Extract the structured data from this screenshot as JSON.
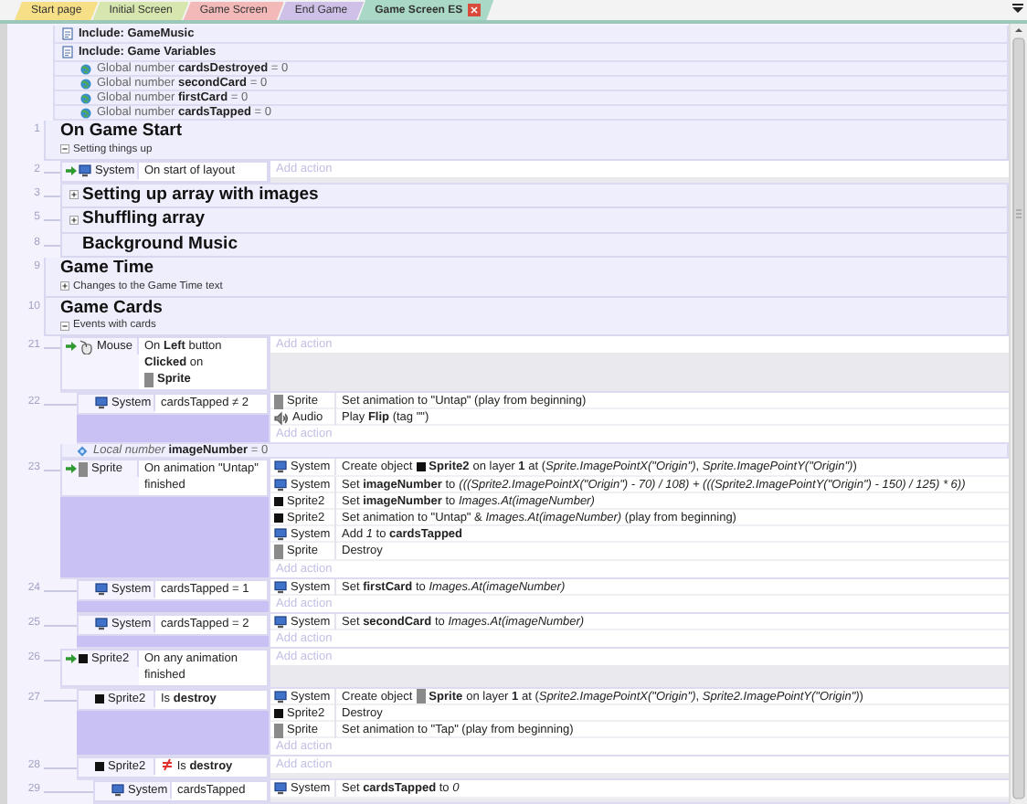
{
  "tabs": [
    {
      "label": "Start page",
      "selected": false,
      "color": "#f6df86"
    },
    {
      "label": "Initial Screen",
      "selected": false,
      "color": "#d6e6ae"
    },
    {
      "label": "Game Screen",
      "selected": false,
      "color": "#f3b9b9"
    },
    {
      "label": "End Game",
      "selected": false,
      "color": "#cfc0e8"
    },
    {
      "label": "Game Screen ES",
      "selected": true,
      "color": "#a9d8c6"
    }
  ],
  "sheet": [
    {
      "kind": "include",
      "text": "Include: GameMusic"
    },
    {
      "kind": "include",
      "text": "Include: Game Variables"
    },
    {
      "kind": "global",
      "text": "Global number **cardsDestroyed** = 0"
    },
    {
      "kind": "global",
      "text": "Global number **secondCard** = 0"
    },
    {
      "kind": "global",
      "text": "Global number **firstCard** = 0"
    },
    {
      "kind": "global",
      "text": "Global number **cardsTapped** = 0"
    },
    {
      "kind": "group",
      "line": "1",
      "title": "On Game Start",
      "description": "Setting things up",
      "expanded": true,
      "children": [
        {
          "kind": "event",
          "line": "2",
          "conditions": [
            {
              "kind": "system",
              "object": "System",
              "trigger": true,
              "inverted": false,
              "text": "On start of layout"
            }
          ],
          "add_action": "Add action"
        },
        {
          "kind": "group",
          "line": "3",
          "title": "Setting up array with images",
          "expanded": false
        },
        {
          "kind": "group",
          "line": "5",
          "title": "Shuffling array",
          "expanded": false
        },
        {
          "kind": "group",
          "line": "8",
          "title": "Background Music"
        }
      ]
    },
    {
      "kind": "group",
      "line": "9",
      "title": "Game Time",
      "description": "Changes to the Game Time text",
      "expanded": false
    },
    {
      "kind": "group",
      "line": "10",
      "title": "Game Cards",
      "description": "Events with cards",
      "expanded": true,
      "children": [
        {
          "kind": "event",
          "line": "21",
          "conditions": [
            {
              "kind": "mouse",
              "object": "Mouse",
              "trigger": true,
              "inverted": false,
              "text": "On **Left** button **Clicked** on",
              "target": {
                "kind": "sprite",
                "name": "Sprite"
              }
            }
          ],
          "add_action": "Add action",
          "children": [
            {
              "kind": "event",
              "line": "22",
              "conditions": [
                {
                  "kind": "system",
                  "object": "System",
                  "trigger": false,
                  "inverted": false,
                  "text": "cardsTapped ≠ 2"
                }
              ],
              "actions": [
                {
                  "kind": "sprite",
                  "object": "Sprite",
                  "text": "Set animation to \"Untap\" (play from beginning)"
                },
                {
                  "kind": "audio",
                  "object": "Audio",
                  "text": "Play **Flip** (tag \"\")"
                }
              ],
              "add_action": "Add action"
            }
          ]
        },
        {
          "kind": "local",
          "text": "*Local number* **imageNumber** = 0"
        },
        {
          "kind": "event",
          "line": "23",
          "conditions": [
            {
              "kind": "sprite",
              "object": "Sprite",
              "trigger": true,
              "inverted": false,
              "text": "On animation \"Untap\" finished"
            }
          ],
          "actions": [
            {
              "kind": "system",
              "object": "System",
              "text": "Create object",
              "target": {
                "kind": "sprite2",
                "name": "Sprite2"
              },
              "rest": "on layer **1** at (*Sprite.ImagePointX(\"Origin\")*, *Sprite.ImagePointY(\"Origin\")*)"
            },
            {
              "kind": "system",
              "object": "System",
              "text": "Set **imageNumber** to",
              "expression": "(((Sprite2.ImagePointX(\"Origin\") - 70) / 108) + (((Sprite2.ImagePointY(\"Origin\") - 150) / 125) * 6))"
            },
            {
              "kind": "sprite2",
              "object": "Sprite2",
              "text": "Set **imageNumber** to *Images.At(imageNumber)*"
            },
            {
              "kind": "sprite2",
              "object": "Sprite2",
              "text": "Set animation to \"Untap\" & *Images.At(imageNumber)* (play from beginning)"
            },
            {
              "kind": "system",
              "object": "System",
              "text": "Add *1* to **cardsTapped**"
            },
            {
              "kind": "sprite",
              "object": "Sprite",
              "text": "Destroy"
            }
          ],
          "add_action": "Add action",
          "children": [
            {
              "kind": "event",
              "line": "24",
              "conditions": [
                {
                  "kind": "system",
                  "object": "System",
                  "trigger": false,
                  "inverted": false,
                  "text": "cardsTapped = 1"
                }
              ],
              "actions": [
                {
                  "kind": "system",
                  "object": "System",
                  "text": "Set **firstCard** to *Images.At(imageNumber)*"
                }
              ],
              "add_action": "Add action"
            },
            {
              "kind": "event",
              "line": "25",
              "conditions": [
                {
                  "kind": "system",
                  "object": "System",
                  "trigger": false,
                  "inverted": false,
                  "text": "cardsTapped = 2"
                }
              ],
              "actions": [
                {
                  "kind": "system",
                  "object": "System",
                  "text": "Set **secondCard** to *Images.At(imageNumber)*"
                }
              ],
              "add_action": "Add action"
            }
          ]
        },
        {
          "kind": "event",
          "line": "26",
          "conditions": [
            {
              "kind": "sprite2",
              "object": "Sprite2",
              "trigger": true,
              "inverted": false,
              "text": "On any animation finished"
            }
          ],
          "add_action": "Add action",
          "children": [
            {
              "kind": "event",
              "line": "27",
              "conditions": [
                {
                  "kind": "sprite2",
                  "object": "Sprite2",
                  "trigger": false,
                  "inverted": false,
                  "text": "Is **destroy**"
                }
              ],
              "actions": [
                {
                  "kind": "system",
                  "object": "System",
                  "text": "Create object",
                  "target": {
                    "kind": "sprite",
                    "name": "Sprite"
                  },
                  "rest": "on layer **1** at (*Sprite2.ImagePointX(\"Origin\")*, *Sprite2.ImagePointY(\"Origin\")*)"
                },
                {
                  "kind": "sprite2",
                  "object": "Sprite2",
                  "text": "Destroy"
                },
                {
                  "kind": "sprite",
                  "object": "Sprite",
                  "text": "Set animation to \"Tap\" (play from beginning)"
                }
              ],
              "add_action": "Add action"
            },
            {
              "kind": "event",
              "line": "28",
              "conditions": [
                {
                  "kind": "sprite2",
                  "object": "Sprite2",
                  "trigger": false,
                  "inverted": true,
                  "text": "Is **destroy**"
                }
              ],
              "add_action": "Add action",
              "children": [
                {
                  "kind": "event",
                  "line": "29",
                  "conditions": [
                    {
                      "kind": "system",
                      "object": "System",
                      "trigger": false,
                      "inverted": false,
                      "text": "cardsTapped"
                    }
                  ],
                  "actions": [
                    {
                      "kind": "system",
                      "object": "System",
                      "text": "Set **cardsTapped** to *0*"
                    }
                  ]
                }
              ]
            }
          ]
        }
      ]
    }
  ]
}
